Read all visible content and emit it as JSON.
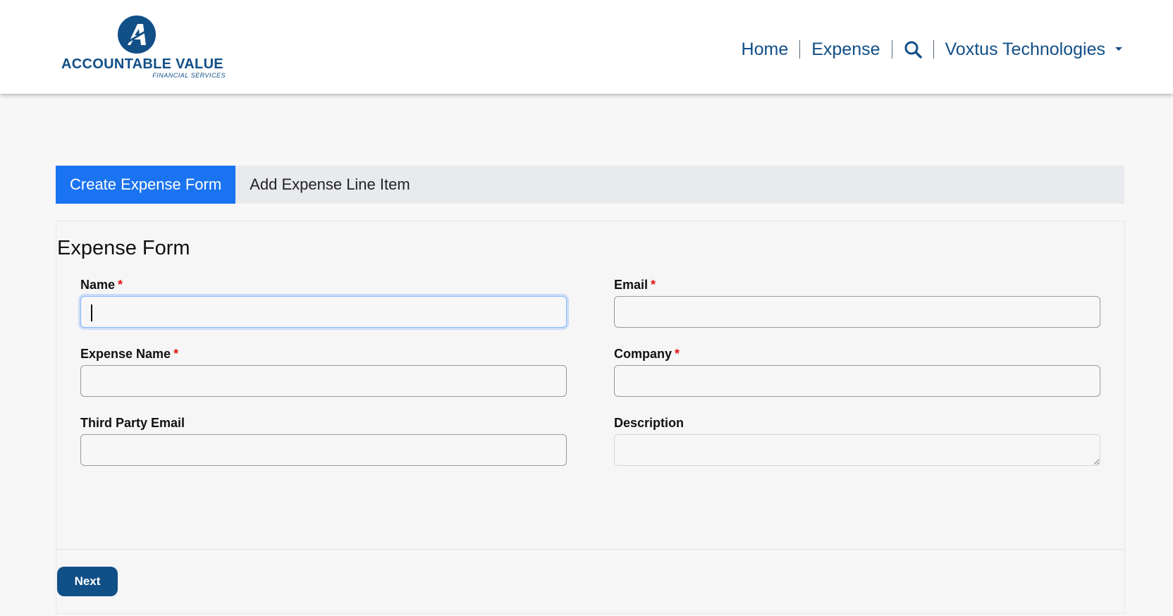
{
  "header": {
    "logo": {
      "name": "ACCOUNTABLE VALUE",
      "tagline": "FINANCIAL SERVICES",
      "icon": "letter-a-logo-icon"
    },
    "nav": {
      "home": "Home",
      "expense": "Expense",
      "search_icon": "search-icon",
      "company_menu": "Voxtus Technologies"
    }
  },
  "tabs": [
    {
      "label": "Create Expense Form",
      "active": true
    },
    {
      "label": "Add Expense Line Item",
      "active": false
    }
  ],
  "form": {
    "title": "Expense Form",
    "required_marker": "*",
    "fields": {
      "name": {
        "label": "Name",
        "required": true,
        "value": ""
      },
      "email": {
        "label": "Email",
        "required": true,
        "value": ""
      },
      "expense_name": {
        "label": "Expense Name",
        "required": true,
        "value": ""
      },
      "company": {
        "label": "Company",
        "required": true,
        "value": ""
      },
      "third_party_email": {
        "label": "Third Party Email",
        "required": false,
        "value": ""
      },
      "description": {
        "label": "Description",
        "required": false,
        "value": ""
      }
    },
    "next_label": "Next"
  },
  "colors": {
    "brand": "#114f87",
    "active_tab": "#1a73f0",
    "required": "#e01515"
  }
}
